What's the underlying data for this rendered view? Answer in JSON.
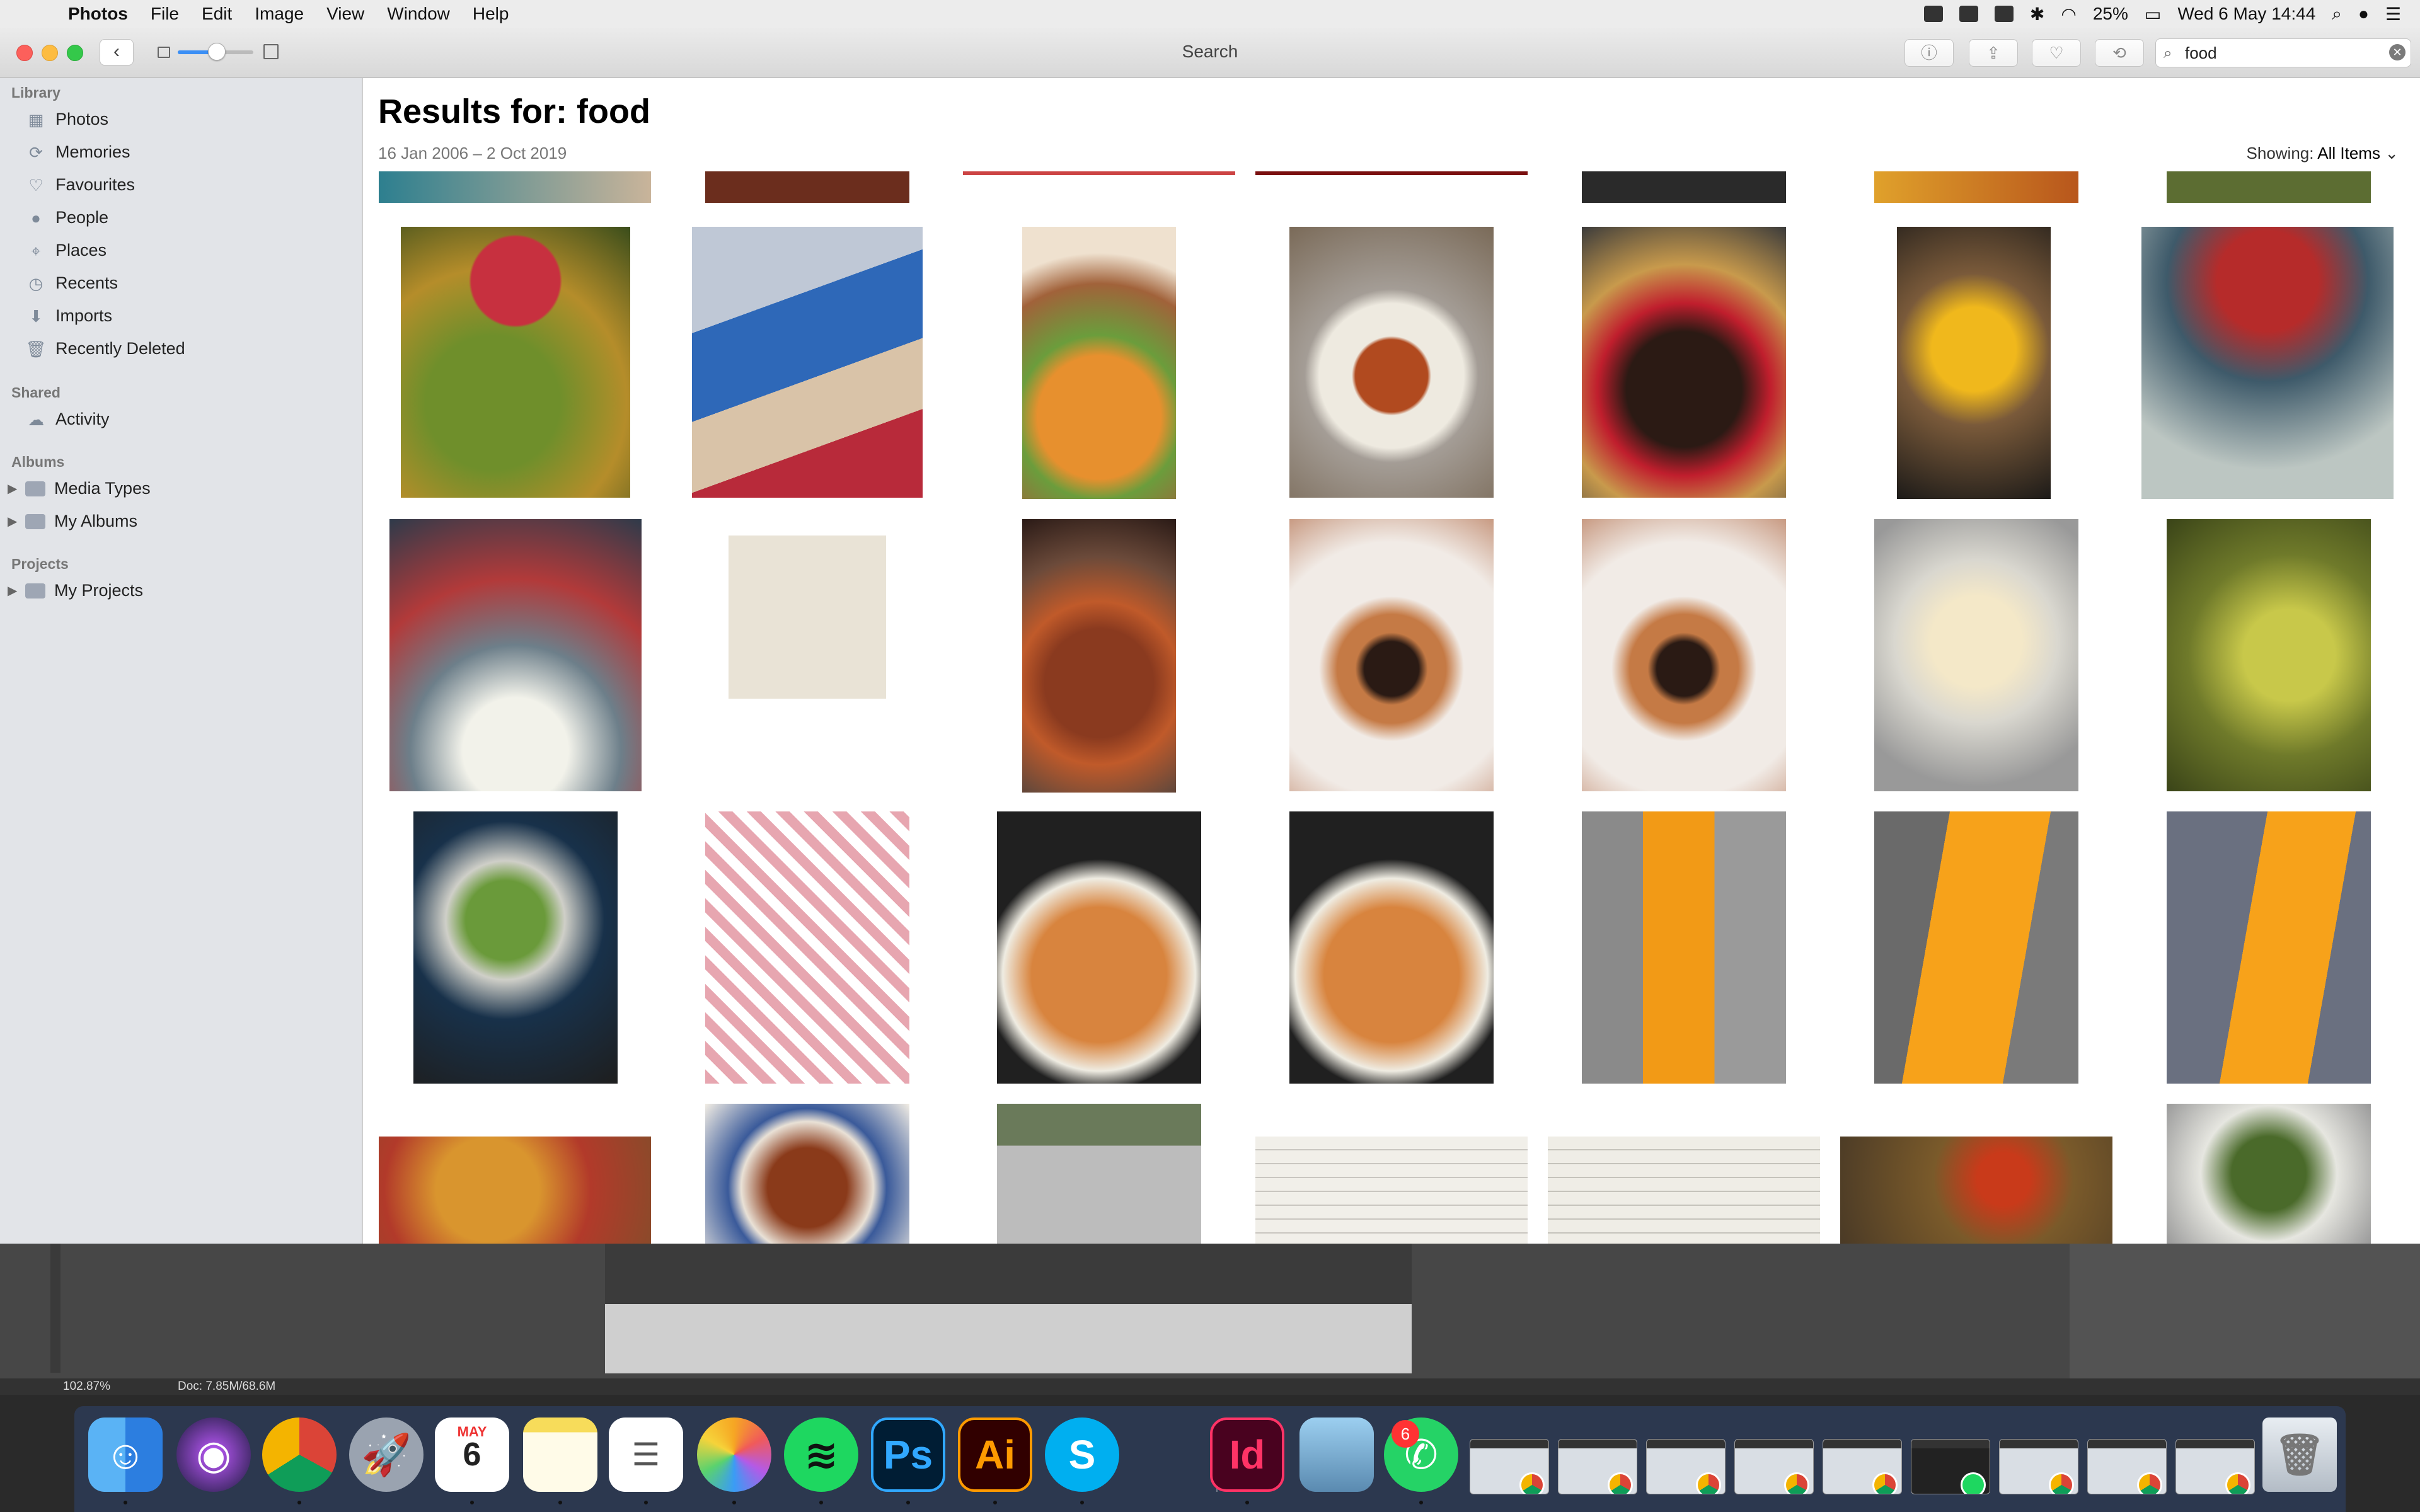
{
  "menubar": {
    "app": "Photos",
    "items": [
      "File",
      "Edit",
      "Image",
      "View",
      "Window",
      "Help"
    ],
    "battery": "25%",
    "datetime": "Wed 6 May  14:44"
  },
  "toolbar": {
    "title": "Search",
    "search_value": "food",
    "search_clear": "✕"
  },
  "sidebar": {
    "sections": {
      "library": "Library",
      "shared": "Shared",
      "albums": "Albums",
      "projects": "Projects"
    },
    "library_items": [
      "Photos",
      "Memories",
      "Favourites",
      "People",
      "Places",
      "Recents",
      "Imports",
      "Recently Deleted"
    ],
    "shared_items": [
      "Activity"
    ],
    "album_items": [
      "Media Types",
      "My Albums"
    ],
    "project_items": [
      "My Projects"
    ]
  },
  "main": {
    "title": "Results for: food",
    "date_range": "16 Jan 2006 – 2 Oct 2019",
    "showing_label": "Showing:",
    "showing_value": "All Items"
  },
  "photoshop": {
    "zoom": "102.87%",
    "doc": "Doc: 7.85M/68.6M"
  },
  "dock": {
    "items": [
      "Finder",
      "Siri",
      "Chrome",
      "Launchpad",
      "Calendar",
      "Notes",
      "Reminders",
      "Photos",
      "Spotify",
      "Photoshop",
      "Illustrator",
      "Skype",
      "InDesign",
      "Preview",
      "WhatsApp"
    ],
    "calendar_month": "MAY",
    "calendar_day": "6",
    "ps_label": "Ps",
    "ai_label": "Ai",
    "id_label": "Id",
    "whatsapp_badge": "6"
  },
  "colors": {
    "accent": "#3b8ff5",
    "sidebar_bg": "#e2e4e8",
    "close": "#fc605b",
    "minimize": "#fdbc40",
    "maximize": "#34c84a"
  }
}
